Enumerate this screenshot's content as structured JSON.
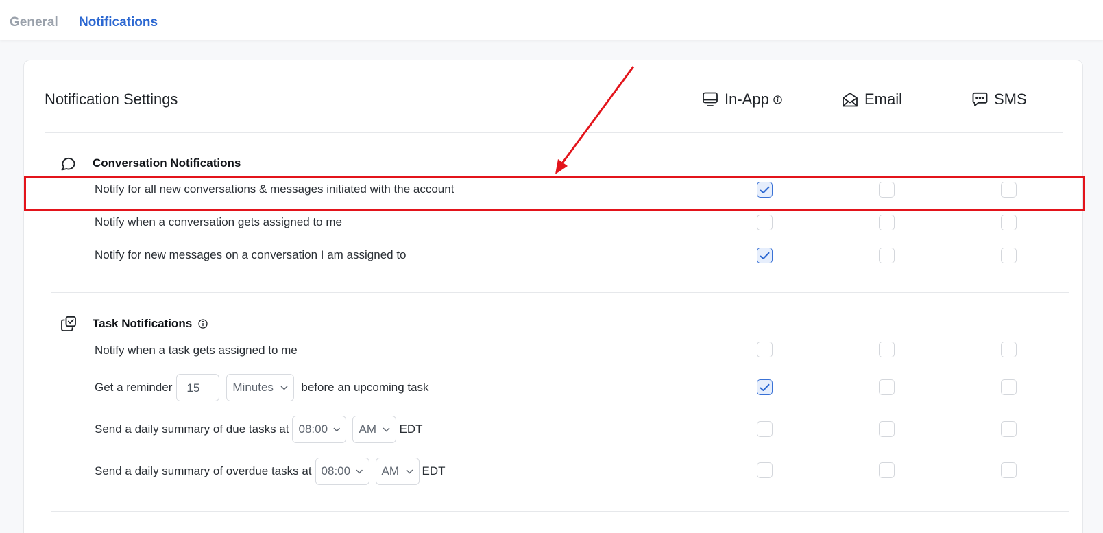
{
  "tabs": [
    {
      "label": "General",
      "active": false
    },
    {
      "label": "Notifications",
      "active": true
    }
  ],
  "header": {
    "title": "Notification Settings",
    "columns": [
      {
        "label": "In-App",
        "icon": "monitor-icon",
        "has_info": true
      },
      {
        "label": "Email",
        "icon": "envelope-open-icon",
        "has_info": false
      },
      {
        "label": "SMS",
        "icon": "chat-dots-icon",
        "has_info": false
      }
    ]
  },
  "sections": [
    {
      "title": "Conversation Notifications",
      "icon": "chat-bubble-icon",
      "rows": [
        {
          "label": "Notify for all new conversations & messages initiated with the account",
          "in_app": true,
          "email": false,
          "sms": false
        },
        {
          "label": "Notify when a conversation gets assigned to me",
          "in_app": false,
          "email": false,
          "sms": false
        },
        {
          "label": "Notify for new messages on a conversation I am assigned to",
          "in_app": true,
          "email": false,
          "sms": false
        }
      ]
    },
    {
      "title": "Task Notifications",
      "icon": "task-checkbox-stack-icon",
      "has_info": true,
      "rows": [
        {
          "label": "Notify when a task gets assigned to me",
          "in_app": false,
          "email": false,
          "sms": false
        },
        {
          "label_before": "Get a reminder",
          "value": "15",
          "unit": "Minutes",
          "label_after": "before an upcoming task",
          "in_app": true,
          "email": false,
          "sms": false
        },
        {
          "label_before": "Send a daily summary of due tasks at",
          "time": "08:00",
          "period": "AM",
          "tz": "EDT",
          "in_app": false,
          "email": false,
          "sms": false
        },
        {
          "label_before": "Send a daily summary of overdue tasks at",
          "time": "08:00",
          "period": "AM",
          "tz": "EDT",
          "in_app": false,
          "email": false,
          "sms": false
        }
      ]
    }
  ],
  "colors": {
    "accent": "#2b67d1",
    "highlight": "#e3141b",
    "checked_bg": "#e6eefc"
  }
}
